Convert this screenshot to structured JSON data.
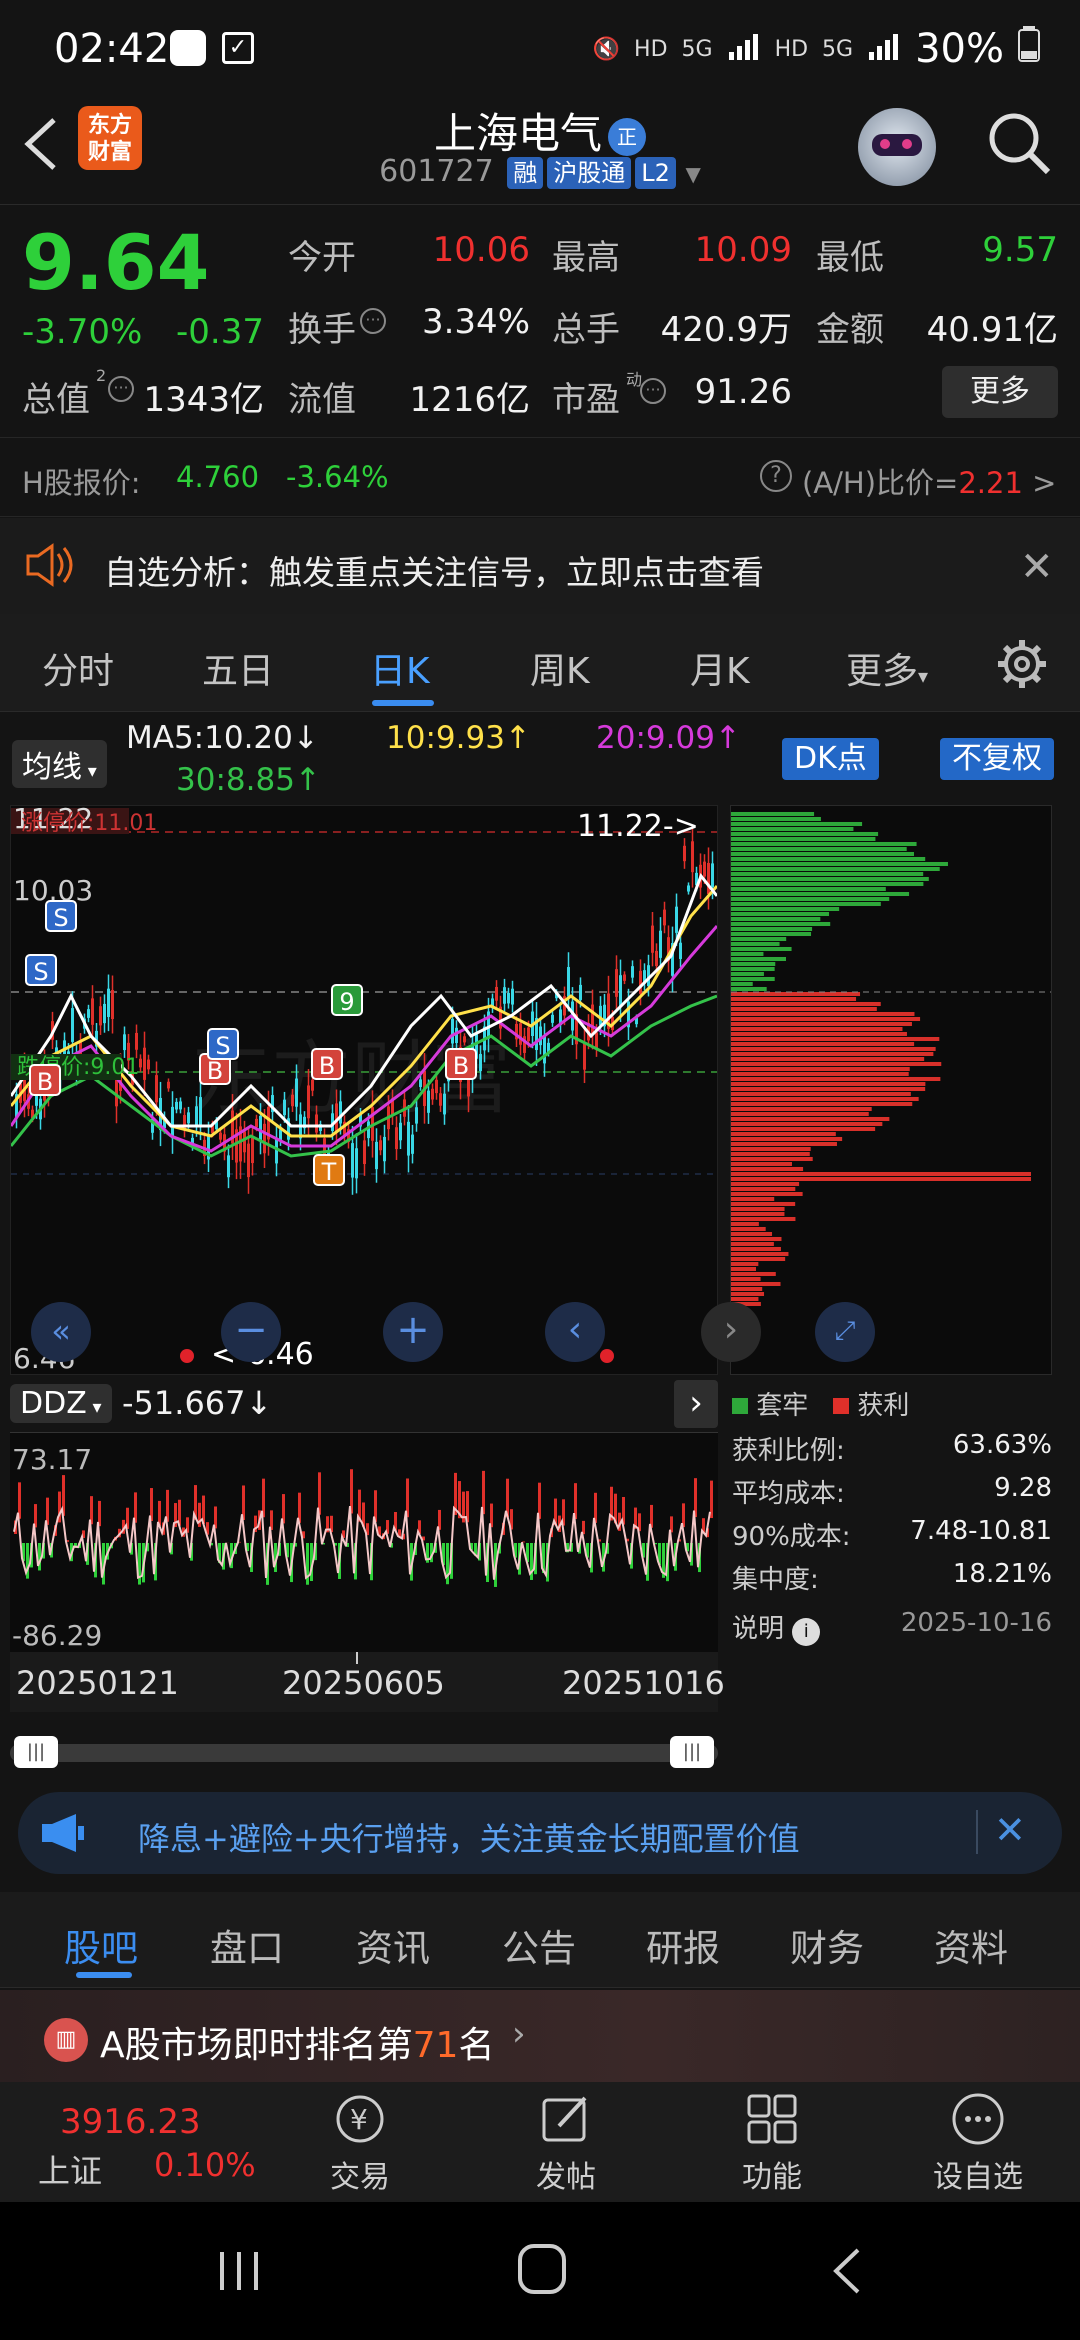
{
  "status_bar": {
    "time": "02:42",
    "battery": "30%",
    "net1": "HD",
    "net2": "5G",
    "net3": "HD",
    "net4": "5G"
  },
  "header": {
    "logo_text": "东方财富",
    "stock_name": "上海电气",
    "name_badge": "正",
    "code": "601727",
    "tags": [
      "融",
      "沪股通",
      "L2"
    ]
  },
  "quote": {
    "price": "9.64",
    "change_pct": "-3.70%",
    "change": "-0.37",
    "fields": [
      {
        "label": "今开",
        "value": "10.06",
        "color": "#f0302f"
      },
      {
        "label": "最高",
        "value": "10.09",
        "color": "#f0302f"
      },
      {
        "label": "最低",
        "value": "9.57",
        "color": "#2ed03a"
      },
      {
        "label": "换手",
        "value": "3.34%",
        "color": "#f2f2f2"
      },
      {
        "label": "总手",
        "value": "420.9万",
        "color": "#f2f2f2"
      },
      {
        "label": "金额",
        "value": "40.91亿",
        "color": "#f2f2f2"
      },
      {
        "label": "总值",
        "value": "1343亿",
        "color": "#f2f2f2"
      },
      {
        "label": "流值",
        "value": "1216亿",
        "color": "#f2f2f2"
      },
      {
        "label": "市盈",
        "value": "91.26",
        "color": "#f2f2f2"
      }
    ],
    "more_label": "更多"
  },
  "hshare": {
    "label": "H股报价:",
    "price": "4.760",
    "pct": "-3.64%",
    "ah_label": "(A/H)比价=",
    "ah_value": "2.21",
    "arrow": ">"
  },
  "alert": {
    "text": "自选分析：触发重点关注信号，立即点击查看"
  },
  "tabs": [
    "分时",
    "五日",
    "日K",
    "周K",
    "月K",
    "更多"
  ],
  "active_tab": "日K",
  "ma_row": {
    "ma_button": "均线",
    "ma5": "MA5:10.20↓",
    "ma10": "10:9.93↑",
    "ma20": "20:9.09↑",
    "ma30": "30:8.85↑",
    "dk_button": "DK点",
    "fq_button": "不复权"
  },
  "kchart": {
    "top_label": "11.22",
    "stop_label": "涨停价:11.01",
    "mid_label": "10.03",
    "fall_label": "跌停价:9.01",
    "low_label": "6.46",
    "max_marker": "11.22->",
    "min_marker": "<-6.46",
    "markers": [
      {
        "t": "S",
        "c": "#2e68c7"
      },
      {
        "t": "S",
        "c": "#2e68c7"
      },
      {
        "t": "B",
        "c": "#d3433b"
      },
      {
        "t": "B",
        "c": "#d3433b"
      },
      {
        "t": "9",
        "c": "#2a9a3a"
      },
      {
        "t": "B",
        "c": "#d3433b"
      },
      {
        "t": "S",
        "c": "#2e68c7"
      },
      {
        "t": "B",
        "c": "#d3433b"
      },
      {
        "t": "T",
        "c": "#e07a12"
      }
    ]
  },
  "ddz": {
    "label": "DDZ",
    "value": "-51.667↓",
    "max": "73.17",
    "min": "-86.29"
  },
  "dates": [
    "20250121",
    "20250605",
    "20251016"
  ],
  "chip": {
    "legend_trapped": "套牢",
    "legend_profit": "获利",
    "stats": [
      {
        "label": "获利比例:",
        "value": "63.63%"
      },
      {
        "label": "平均成本:",
        "value": "9.28"
      },
      {
        "label": "90%成本:",
        "value": "7.48-10.81"
      },
      {
        "label": "集中度:",
        "value": "18.21%"
      }
    ],
    "note_label": "说明",
    "note_date": "2025-10-16"
  },
  "banner": {
    "text": "降息+避险+央行增持，关注黄金长期配置价值"
  },
  "sub_tabs": [
    "股吧",
    "盘口",
    "资讯",
    "公告",
    "研报",
    "财务",
    "资料"
  ],
  "rank": {
    "prefix": "A股市场即时排名第",
    "number": "71",
    "suffix": "名"
  },
  "bottom_nav": {
    "index_value": "3916.23",
    "index_name": "上证",
    "index_pct": "0.10%",
    "items": [
      "交易",
      "发帖",
      "功能",
      "设自选"
    ]
  }
}
